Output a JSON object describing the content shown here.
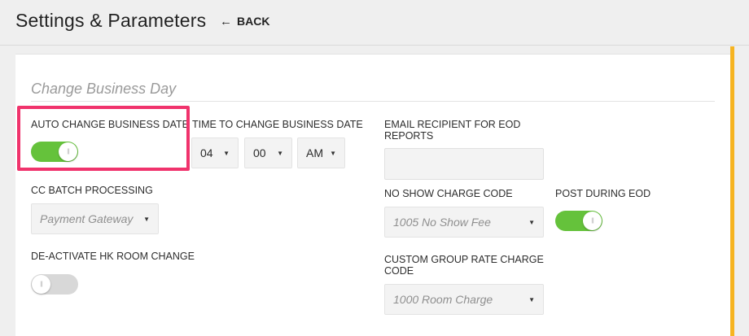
{
  "header": {
    "title": "Settings & Parameters",
    "back_label": "BACK"
  },
  "section": {
    "title": "Change Business Day"
  },
  "fields": {
    "auto_change": {
      "label": "AUTO CHANGE BUSINESS DATE",
      "state": "on"
    },
    "time_to_change": {
      "label": "TIME TO CHANGE BUSINESS DATE",
      "hour": "04",
      "minute": "00",
      "ampm": "AM"
    },
    "email_recipient": {
      "label": "EMAIL RECIPIENT FOR EOD REPORTS",
      "value": ""
    },
    "cc_batch": {
      "label": "CC BATCH PROCESSING",
      "value": "Payment Gateway"
    },
    "no_show": {
      "label": "NO SHOW CHARGE CODE",
      "value": "1005 No Show Fee"
    },
    "post_during_eod": {
      "label": "POST DURING EOD",
      "state": "on"
    },
    "deactivate_hk": {
      "label": "DE-ACTIVATE HK ROOM CHANGE",
      "state": "off"
    },
    "custom_group": {
      "label": "CUSTOM GROUP RATE CHARGE CODE",
      "value": "1000 Room Charge"
    }
  },
  "colors": {
    "toggle_on": "#65c23b",
    "toggle_off": "#d8d8d8",
    "highlight": "#f0336c",
    "accent": "#f6b421"
  },
  "icons": {
    "back": "arrow-left-icon",
    "dropdown": "caret-down-icon"
  }
}
